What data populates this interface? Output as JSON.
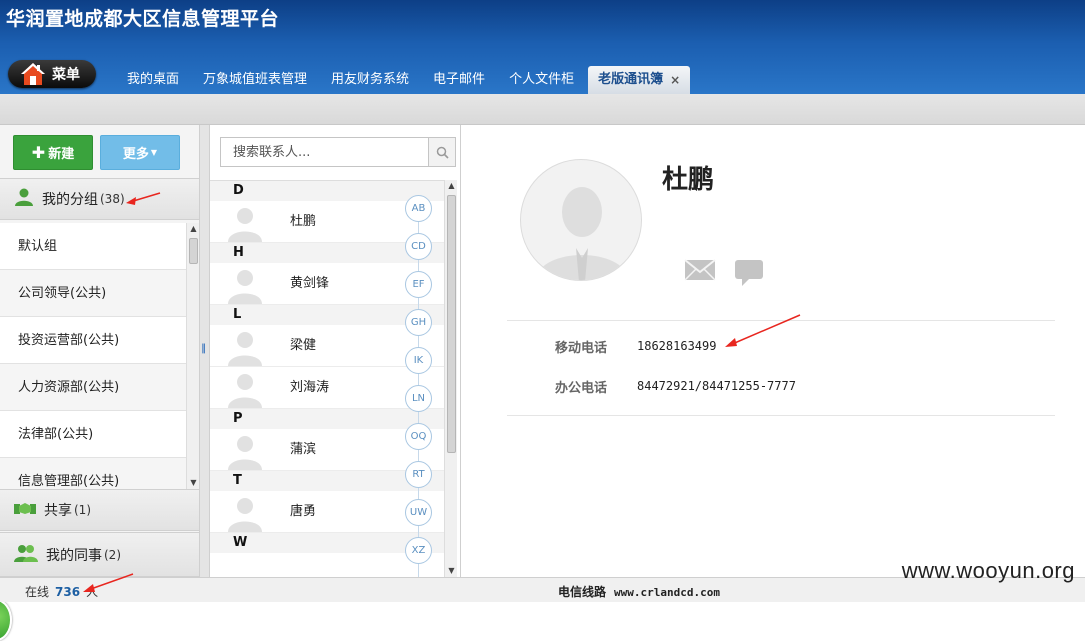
{
  "app": {
    "title": "华润置地成都大区信息管理平台"
  },
  "menu": {
    "label": "菜单",
    "icon": "home-icon"
  },
  "tabs": [
    {
      "label": "我的桌面",
      "active": false
    },
    {
      "label": "万象城值班表管理",
      "active": false
    },
    {
      "label": "用友财务系统",
      "active": false
    },
    {
      "label": "电子邮件",
      "active": false
    },
    {
      "label": "个人文件柜",
      "active": false
    },
    {
      "label": "老版通讯簿",
      "active": true,
      "close": "×"
    }
  ],
  "left": {
    "new_button": "新建",
    "more_button": "更多",
    "my_groups": {
      "label": "我的分组",
      "count": "(38)"
    },
    "groups": [
      "默认组",
      "公司领导(公共)",
      "投资运营部(公共)",
      "人力资源部(公共)",
      "法律部(公共)",
      "信息管理部(公共)"
    ],
    "shared": {
      "label": "共享",
      "count": "(1)"
    },
    "colleagues": {
      "label": "我的同事",
      "count": "(2)"
    }
  },
  "middle": {
    "search": {
      "placeholder": "搜索联系人..."
    },
    "sections": [
      {
        "letter": "D",
        "contacts": [
          "杜鹏"
        ]
      },
      {
        "letter": "H",
        "contacts": [
          "黄剑锋"
        ]
      },
      {
        "letter": "L",
        "contacts": [
          "梁健",
          "刘海涛"
        ]
      },
      {
        "letter": "P",
        "contacts": [
          "蒲滨"
        ]
      },
      {
        "letter": "T",
        "contacts": [
          "唐勇"
        ]
      },
      {
        "letter": "W",
        "contacts": []
      }
    ],
    "alpha_index": [
      "AB",
      "CD",
      "EF",
      "GH",
      "IK",
      "LN",
      "OQ",
      "RT",
      "UW",
      "XZ"
    ]
  },
  "detail": {
    "name": "杜鹏",
    "mobile_label": "移动电话",
    "mobile": "18628163499",
    "office_label": "办公电话",
    "office": "84472921/84471255-7777"
  },
  "footer": {
    "online_label": "在线",
    "online_count": "736",
    "online_unit": "人",
    "line_label": "电信线路",
    "line_url": "www.crlandcd.com"
  },
  "watermark": "www.wooyun.org",
  "colors": {
    "header": "#1b5eb0",
    "new_button": "#3aa33d",
    "more_button": "#72bde8",
    "annotation": "#e8261f"
  }
}
